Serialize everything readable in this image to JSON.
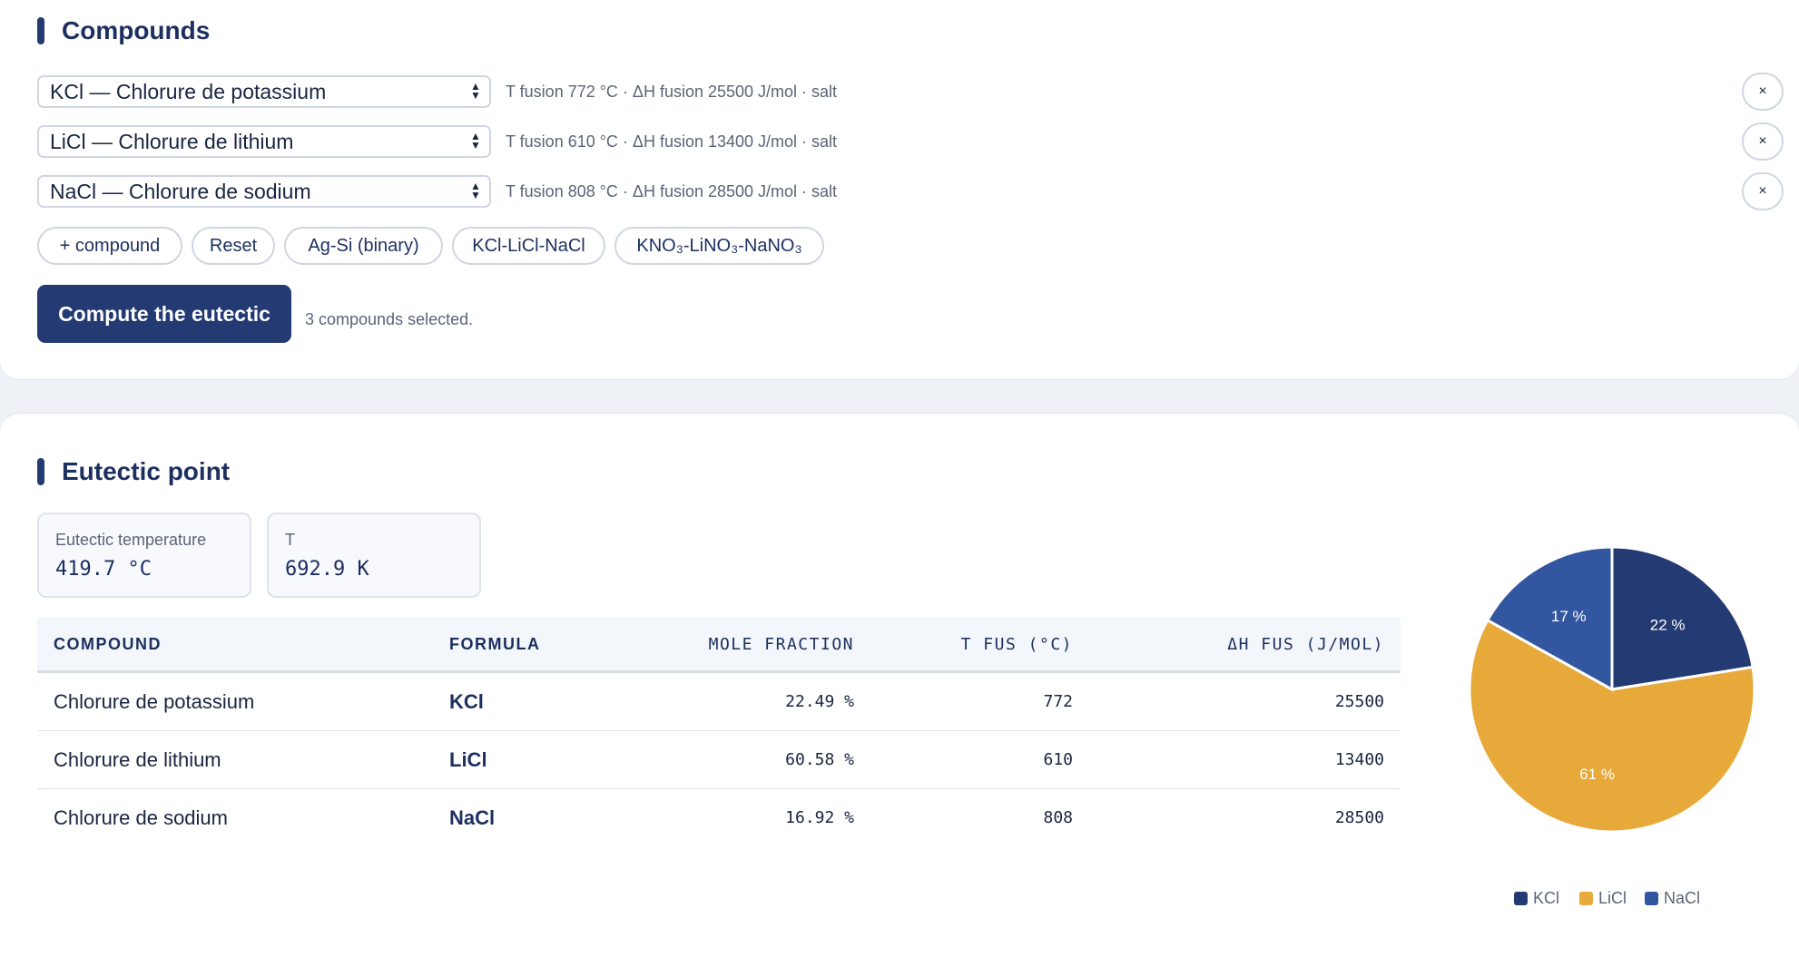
{
  "compounds": {
    "title": "Compounds",
    "rows": [
      {
        "select": "KCl — Chlorure de potassium",
        "meta": "T fusion 772 °C · ΔH fusion 25500 J/mol · salt",
        "remove": "×"
      },
      {
        "select": "LiCl — Chlorure de lithium",
        "meta": "T fusion 610 °C · ΔH fusion 13400 J/mol · salt",
        "remove": "×"
      },
      {
        "select": "NaCl — Chlorure de sodium",
        "meta": "T fusion 808 °C · ΔH fusion 28500 J/mol · salt",
        "remove": "×"
      }
    ],
    "chips": [
      "+ compound",
      "Reset",
      "Ag-Si (binary)",
      "KCl-LiCl-NaCl",
      "KNO₃-LiNO₃-NaNO₃"
    ],
    "compute_label": "Compute the eutectic",
    "status": "3 compounds selected."
  },
  "eutectic": {
    "title": "Eutectic point",
    "stats": [
      {
        "label": "Eutectic temperature",
        "value": "419.7 °C"
      },
      {
        "label": "T",
        "value": "692.9 K"
      }
    ],
    "table": {
      "headers": [
        "COMPOUND",
        "FORMULA",
        "MOLE FRACTION",
        "T FUS (°C)",
        "ΔH FUS (J/MOL)"
      ],
      "rows": [
        {
          "compound": "Chlorure de potassium",
          "formula": "KCl",
          "fraction": "22.49 %",
          "tfus": "772",
          "dh": "25500"
        },
        {
          "compound": "Chlorure de lithium",
          "formula": "LiCl",
          "fraction": "60.58 %",
          "tfus": "610",
          "dh": "13400"
        },
        {
          "compound": "Chlorure de sodium",
          "formula": "NaCl",
          "fraction": "16.92 %",
          "tfus": "808",
          "dh": "28500"
        }
      ]
    }
  },
  "chart_data": {
    "type": "pie",
    "categories": [
      "KCl",
      "LiCl",
      "NaCl"
    ],
    "values": [
      22.49,
      60.58,
      16.92
    ],
    "labels": [
      "22 %",
      "61 %",
      "17 %"
    ],
    "colors": [
      "#233a73",
      "#e8a93b",
      "#3356a0"
    ],
    "legend": "bottom"
  }
}
